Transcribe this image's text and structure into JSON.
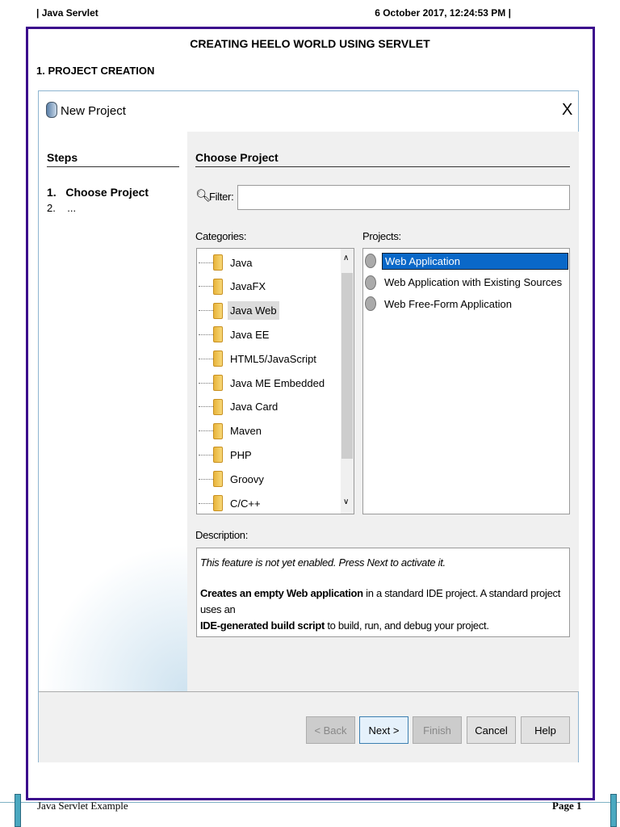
{
  "page_header": {
    "left": "| Java Servlet",
    "right": "6 October 2017, 12:24:53 PM |"
  },
  "doc": {
    "title": "CREATING HEELO WORLD USING SERVLET",
    "section": "1. PROJECT CREATION"
  },
  "dialog": {
    "title": "New Project",
    "close": "X",
    "steps_heading": "Steps",
    "steps": [
      {
        "num": "1.",
        "label": "Choose Project"
      },
      {
        "num": "2.",
        "label": "..."
      }
    ],
    "main_heading": "Choose Project",
    "filter_label": "Filter:",
    "filter_value": "",
    "categories_label": "Categories:",
    "categories": [
      "Java",
      "JavaFX",
      "Java Web",
      "Java EE",
      "HTML5/JavaScript",
      "Java ME Embedded",
      "Java Card",
      "Maven",
      "PHP",
      "Groovy",
      "C/C++"
    ],
    "selected_category": "Java Web",
    "projects_label": "Projects:",
    "projects": [
      "Web Application",
      "Web Application with Existing Sources",
      "Web Free-Form Application"
    ],
    "selected_project": "Web Application",
    "description_label": "Description:",
    "description_note": "This feature is not yet enabled. Press Next to activate it.",
    "desc_b1": "Creates an empty Web application",
    "desc_t1": " in a standard IDE project. A standard project uses an",
    "desc_b2": "IDE-generated build script",
    "desc_t2": " to build, run, and debug your project.",
    "buttons": {
      "back": "< Back",
      "next": "Next >",
      "finish": "Finish",
      "cancel": "Cancel",
      "help": "Help"
    }
  },
  "footer": {
    "left": "Java Servlet Example",
    "right": "Page 1"
  },
  "colors": {
    "frame": "#3b0a8c",
    "selection": "#0a68c8",
    "footer_bar": "#4aa8c0"
  }
}
